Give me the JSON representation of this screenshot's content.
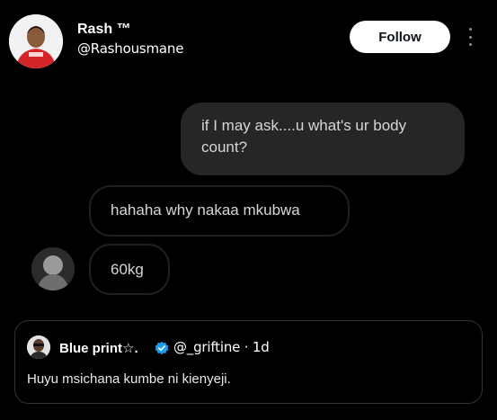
{
  "author": {
    "name": "Rash ™",
    "handle": "@Rashousmane",
    "follow_label": "Follow"
  },
  "chat": {
    "sent_message": "if I may ask....u what's ur body count?",
    "reply_1": "hahaha why nakaa mkubwa",
    "reply_2": "60kg"
  },
  "quote": {
    "name": "Blue print☆.",
    "handle": "@_griftine",
    "time": "· 1d",
    "text": "Huyu msichana kumbe ni kienyeji."
  },
  "colors": {
    "background": "#000000",
    "verified": "#1d9bf0",
    "sent_bubble": "#262626"
  },
  "icons": {
    "more": "more-vertical-icon",
    "verified": "verified-badge-icon"
  }
}
